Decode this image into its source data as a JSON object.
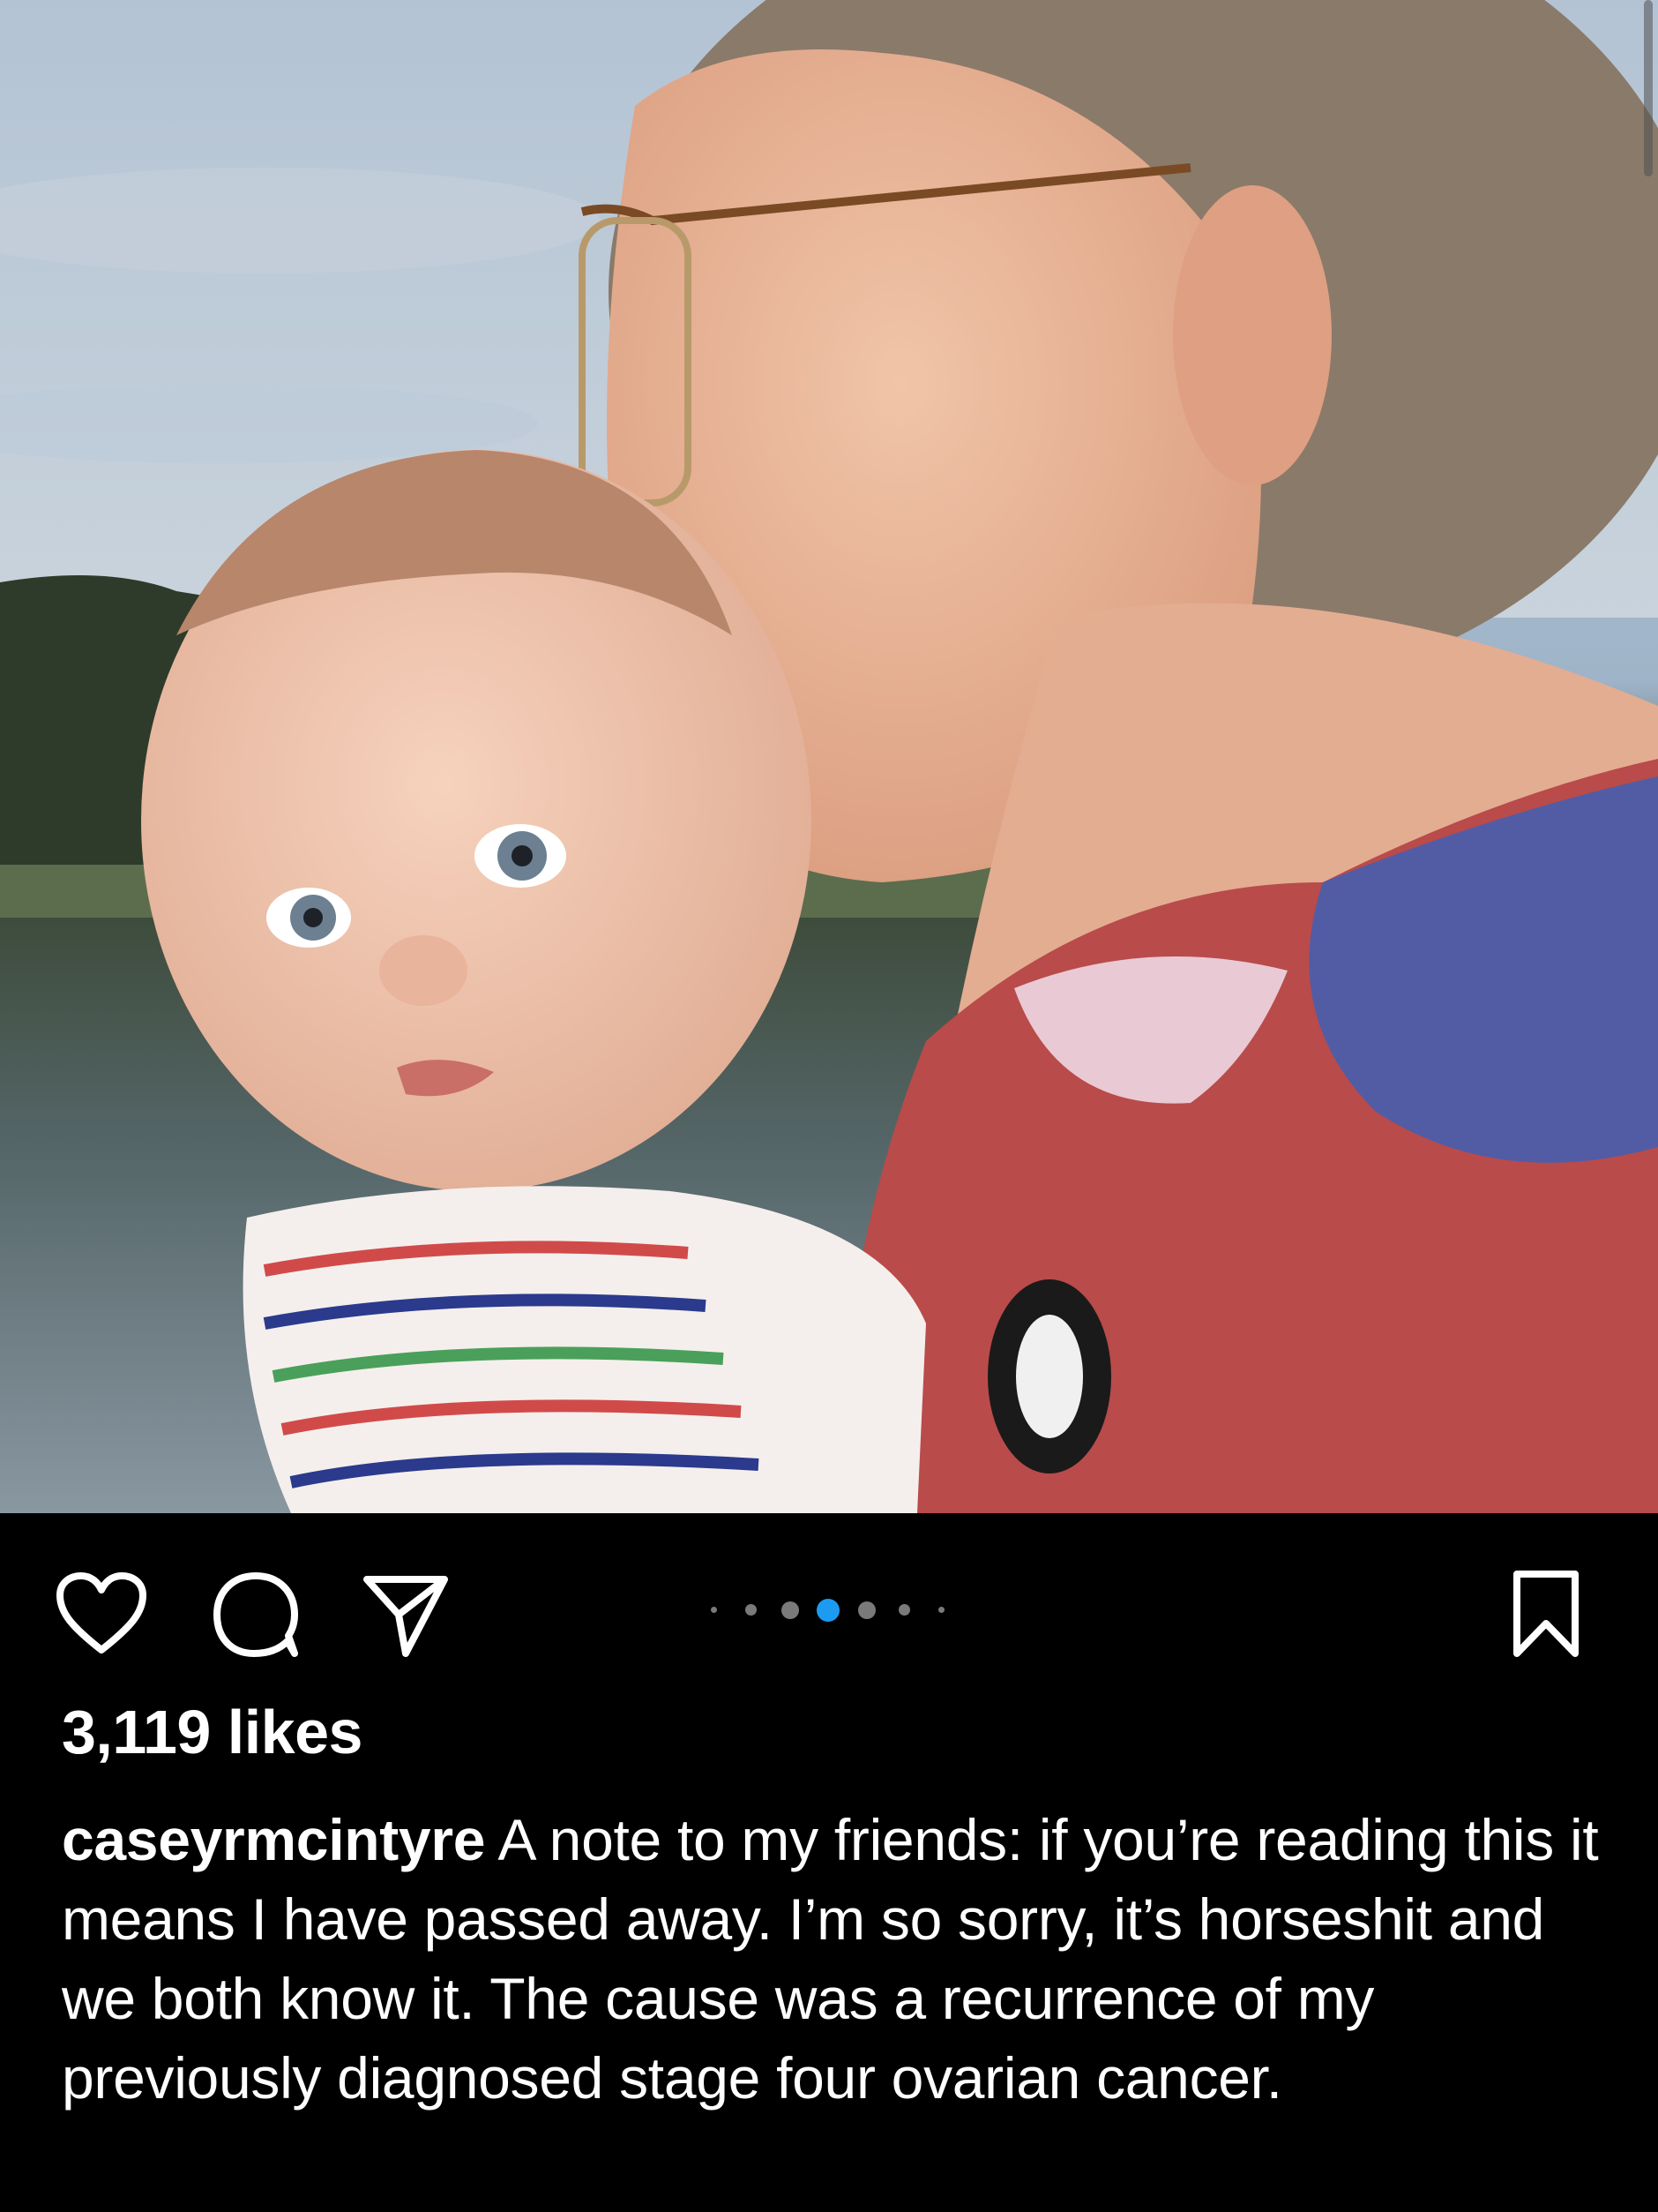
{
  "post": {
    "image_alt": "Photo of a woman with glasses kissing a baby's head by a lake",
    "carousel": {
      "total": 7,
      "active_index": 3,
      "active_color": "#1d9bf0"
    },
    "actions": {
      "like_icon": "heart-outline-icon",
      "comment_icon": "speech-bubble-icon",
      "share_icon": "paper-plane-icon",
      "save_icon": "bookmark-outline-icon"
    },
    "likes_text": "3,119 likes",
    "username": "caseyrmcintyre",
    "caption_text": "A note to my friends: if you’re reading this it means I have passed away. I’m so sorry, it’s horseshit and we both know it. The cause was a recurrence of my previously diagnosed stage four ovarian cancer."
  }
}
